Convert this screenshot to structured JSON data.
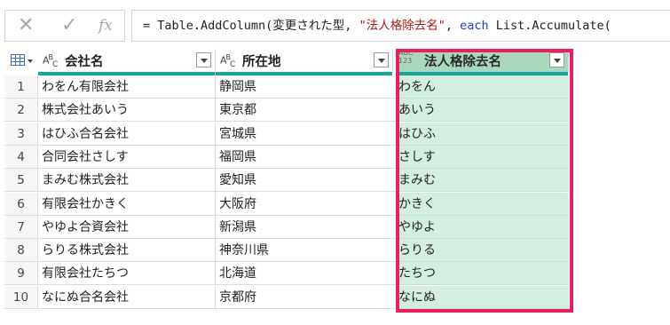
{
  "formula_bar": {
    "cancel_icon": "✕",
    "commit_icon": "✓",
    "fx_label": "fx",
    "formula_prefix": "= Table.AddColumn(変更された型, ",
    "formula_string": "\"法人格除去名\"",
    "formula_mid": ", ",
    "formula_keyword": "each",
    "formula_suffix": " List.Accumulate("
  },
  "colors": {
    "selected_header": "#a9d8bf",
    "selected_cells": "#d4efe1",
    "quality_bar": "#14a898",
    "highlight_box": "#ec1e62"
  },
  "columns": [
    {
      "label": "会社名",
      "type_icon": "ABC"
    },
    {
      "label": "所在地",
      "type_icon": "ABC"
    },
    {
      "label": "法人格除去名",
      "type_icon": "ABC123"
    }
  ],
  "rows": [
    {
      "n": "1",
      "company": "わをん有限会社",
      "location": "静岡県",
      "stripped": "わをん"
    },
    {
      "n": "2",
      "company": "株式会社あいう",
      "location": "東京都",
      "stripped": "あいう"
    },
    {
      "n": "3",
      "company": "はひふ合名会社",
      "location": "宮城県",
      "stripped": "はひふ"
    },
    {
      "n": "4",
      "company": "合同会社さしす",
      "location": "福岡県",
      "stripped": "さしす"
    },
    {
      "n": "5",
      "company": "まみむ株式会社",
      "location": "愛知県",
      "stripped": "まみむ"
    },
    {
      "n": "6",
      "company": "有限会社かきく",
      "location": "大阪府",
      "stripped": "かきく"
    },
    {
      "n": "7",
      "company": "やゆよ合資会社",
      "location": "新潟県",
      "stripped": "やゆよ"
    },
    {
      "n": "8",
      "company": "らりる株式会社",
      "location": "神奈川県",
      "stripped": "らりる"
    },
    {
      "n": "9",
      "company": "有限会社たちつ",
      "location": "北海道",
      "stripped": "たちつ"
    },
    {
      "n": "10",
      "company": "なにぬ合名会社",
      "location": "京都府",
      "stripped": "なにぬ"
    }
  ]
}
